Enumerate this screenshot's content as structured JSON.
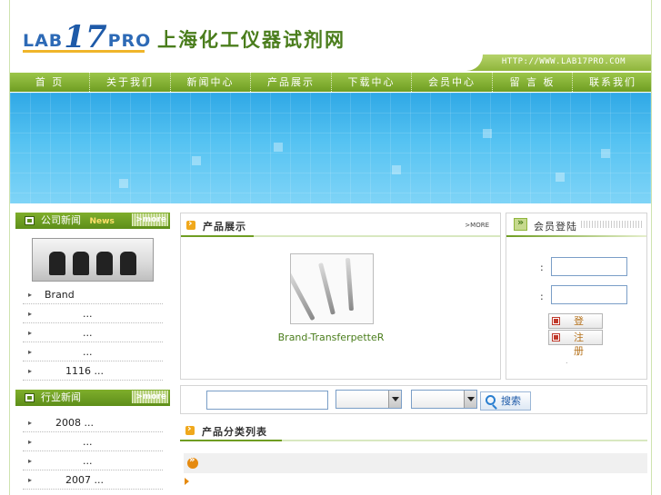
{
  "header": {
    "logo_lab": "LAB",
    "logo_num": "17",
    "logo_pro": "PRO",
    "site_title": "上海化工仪器试剂网",
    "url": "HTTP://WWW.LAB17PRO.COM"
  },
  "nav": {
    "items": [
      {
        "label": "首 页"
      },
      {
        "label": "关于我们"
      },
      {
        "label": "新闻中心"
      },
      {
        "label": "产品展示"
      },
      {
        "label": "下载中心"
      },
      {
        "label": "会员中心"
      },
      {
        "label": "留 言 板"
      },
      {
        "label": "联系我们"
      }
    ]
  },
  "company_news": {
    "title": "公司新闻",
    "title_en": "News",
    "more": ">more",
    "items": [
      {
        "text": "Brand"
      },
      {
        "text": "..."
      },
      {
        "text": "..."
      },
      {
        "text": "..."
      },
      {
        "text": "1116  ..."
      }
    ]
  },
  "industry_news": {
    "title": "行业新闻",
    "more": ">more",
    "items": [
      {
        "text": "2008    ..."
      },
      {
        "text": "..."
      },
      {
        "text": "..."
      },
      {
        "text": "2007  ..."
      }
    ]
  },
  "products": {
    "title": "产品展示",
    "more": ">MORE",
    "item_caption": "Brand-TransferpetteR"
  },
  "login": {
    "title": "会员登陆",
    "colon": ":",
    "login_button": "登 录",
    "register_button": "注 册",
    "dot": "."
  },
  "search": {
    "button": "搜索",
    "select1_value": "",
    "select2_value": ""
  },
  "categories": {
    "title": "产品分类列表"
  },
  "colors": {
    "nav_green": "#7fae2c",
    "banner_blue": "#3fb3ea",
    "title_green": "#4a7d1c",
    "accent_orange": "#f0a81c"
  }
}
